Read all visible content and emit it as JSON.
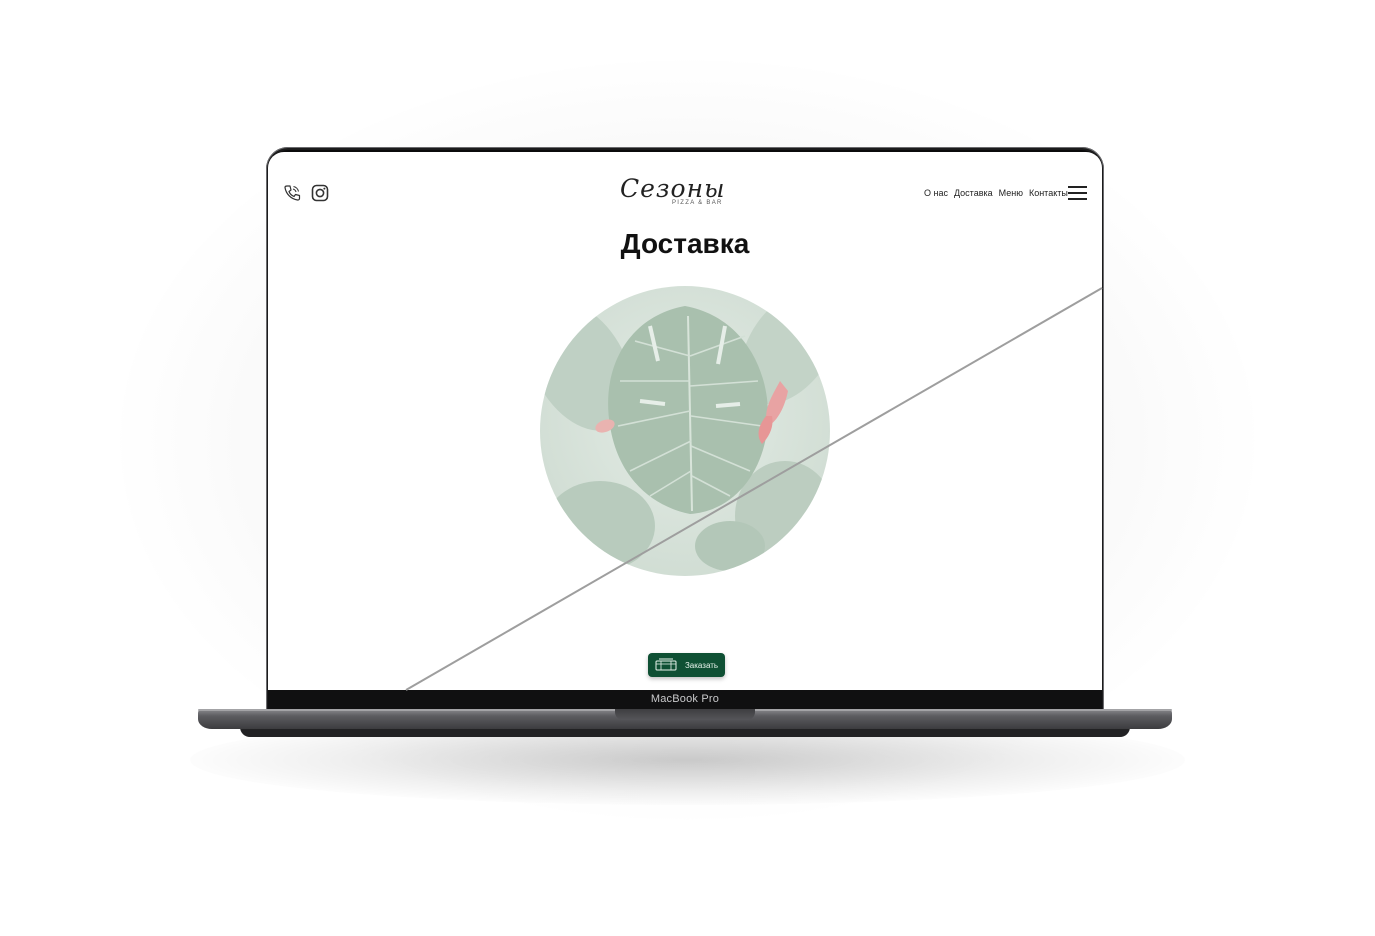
{
  "device": {
    "model_label": "MacBook Pro"
  },
  "site": {
    "logo_script": "Сезоны",
    "logo_sub": "PIZZA & BAR",
    "nav": [
      {
        "label": "О нас"
      },
      {
        "label": "Доставка"
      },
      {
        "label": "Меню"
      },
      {
        "label": "Контакты"
      }
    ],
    "icons": [
      "phone-icon",
      "instagram-icon",
      "menu-burger-icon",
      "delivery-box-icon"
    ],
    "page_title": "Доставка",
    "order_button": {
      "label": "Заказать"
    },
    "colors": {
      "accent": "#0f5034",
      "text": "#111111",
      "leaf_green": "#9bb5a3",
      "flower_pink": "#e88a8a"
    }
  }
}
